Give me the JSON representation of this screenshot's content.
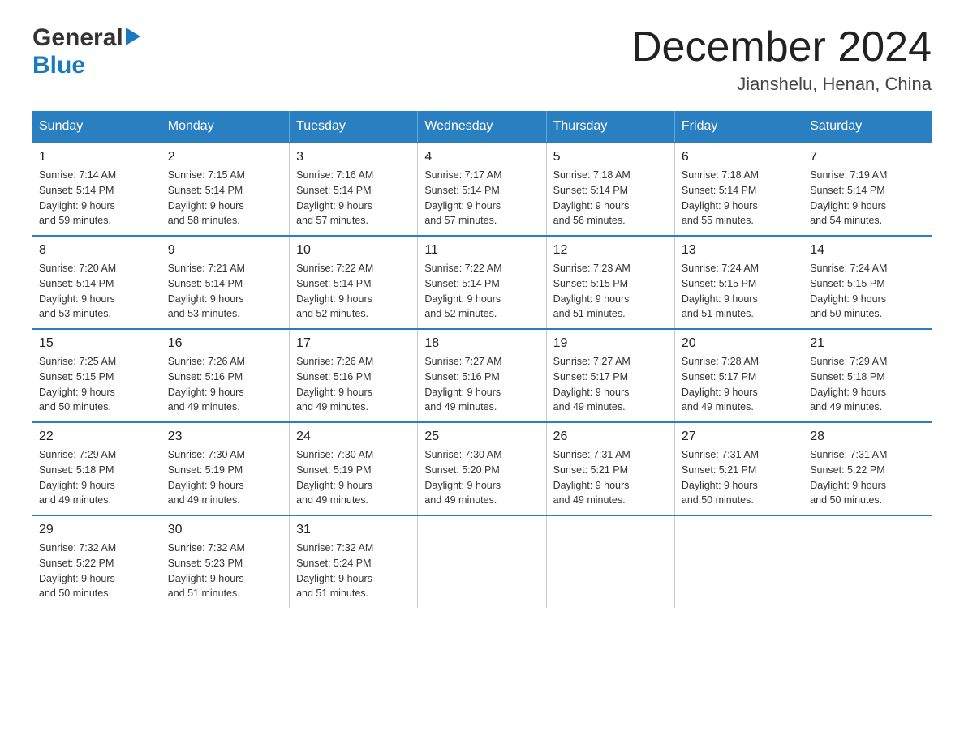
{
  "logo": {
    "general_text": "General",
    "blue_text": "Blue"
  },
  "title": "December 2024",
  "subtitle": "Jianshelu, Henan, China",
  "days_of_week": [
    "Sunday",
    "Monday",
    "Tuesday",
    "Wednesday",
    "Thursday",
    "Friday",
    "Saturday"
  ],
  "weeks": [
    [
      {
        "day": "1",
        "sunrise": "7:14 AM",
        "sunset": "5:14 PM",
        "daylight": "9 hours and 59 minutes."
      },
      {
        "day": "2",
        "sunrise": "7:15 AM",
        "sunset": "5:14 PM",
        "daylight": "9 hours and 58 minutes."
      },
      {
        "day": "3",
        "sunrise": "7:16 AM",
        "sunset": "5:14 PM",
        "daylight": "9 hours and 57 minutes."
      },
      {
        "day": "4",
        "sunrise": "7:17 AM",
        "sunset": "5:14 PM",
        "daylight": "9 hours and 57 minutes."
      },
      {
        "day": "5",
        "sunrise": "7:18 AM",
        "sunset": "5:14 PM",
        "daylight": "9 hours and 56 minutes."
      },
      {
        "day": "6",
        "sunrise": "7:18 AM",
        "sunset": "5:14 PM",
        "daylight": "9 hours and 55 minutes."
      },
      {
        "day": "7",
        "sunrise": "7:19 AM",
        "sunset": "5:14 PM",
        "daylight": "9 hours and 54 minutes."
      }
    ],
    [
      {
        "day": "8",
        "sunrise": "7:20 AM",
        "sunset": "5:14 PM",
        "daylight": "9 hours and 53 minutes."
      },
      {
        "day": "9",
        "sunrise": "7:21 AM",
        "sunset": "5:14 PM",
        "daylight": "9 hours and 53 minutes."
      },
      {
        "day": "10",
        "sunrise": "7:22 AM",
        "sunset": "5:14 PM",
        "daylight": "9 hours and 52 minutes."
      },
      {
        "day": "11",
        "sunrise": "7:22 AM",
        "sunset": "5:14 PM",
        "daylight": "9 hours and 52 minutes."
      },
      {
        "day": "12",
        "sunrise": "7:23 AM",
        "sunset": "5:15 PM",
        "daylight": "9 hours and 51 minutes."
      },
      {
        "day": "13",
        "sunrise": "7:24 AM",
        "sunset": "5:15 PM",
        "daylight": "9 hours and 51 minutes."
      },
      {
        "day": "14",
        "sunrise": "7:24 AM",
        "sunset": "5:15 PM",
        "daylight": "9 hours and 50 minutes."
      }
    ],
    [
      {
        "day": "15",
        "sunrise": "7:25 AM",
        "sunset": "5:15 PM",
        "daylight": "9 hours and 50 minutes."
      },
      {
        "day": "16",
        "sunrise": "7:26 AM",
        "sunset": "5:16 PM",
        "daylight": "9 hours and 49 minutes."
      },
      {
        "day": "17",
        "sunrise": "7:26 AM",
        "sunset": "5:16 PM",
        "daylight": "9 hours and 49 minutes."
      },
      {
        "day": "18",
        "sunrise": "7:27 AM",
        "sunset": "5:16 PM",
        "daylight": "9 hours and 49 minutes."
      },
      {
        "day": "19",
        "sunrise": "7:27 AM",
        "sunset": "5:17 PM",
        "daylight": "9 hours and 49 minutes."
      },
      {
        "day": "20",
        "sunrise": "7:28 AM",
        "sunset": "5:17 PM",
        "daylight": "9 hours and 49 minutes."
      },
      {
        "day": "21",
        "sunrise": "7:29 AM",
        "sunset": "5:18 PM",
        "daylight": "9 hours and 49 minutes."
      }
    ],
    [
      {
        "day": "22",
        "sunrise": "7:29 AM",
        "sunset": "5:18 PM",
        "daylight": "9 hours and 49 minutes."
      },
      {
        "day": "23",
        "sunrise": "7:30 AM",
        "sunset": "5:19 PM",
        "daylight": "9 hours and 49 minutes."
      },
      {
        "day": "24",
        "sunrise": "7:30 AM",
        "sunset": "5:19 PM",
        "daylight": "9 hours and 49 minutes."
      },
      {
        "day": "25",
        "sunrise": "7:30 AM",
        "sunset": "5:20 PM",
        "daylight": "9 hours and 49 minutes."
      },
      {
        "day": "26",
        "sunrise": "7:31 AM",
        "sunset": "5:21 PM",
        "daylight": "9 hours and 49 minutes."
      },
      {
        "day": "27",
        "sunrise": "7:31 AM",
        "sunset": "5:21 PM",
        "daylight": "9 hours and 50 minutes."
      },
      {
        "day": "28",
        "sunrise": "7:31 AM",
        "sunset": "5:22 PM",
        "daylight": "9 hours and 50 minutes."
      }
    ],
    [
      {
        "day": "29",
        "sunrise": "7:32 AM",
        "sunset": "5:22 PM",
        "daylight": "9 hours and 50 minutes."
      },
      {
        "day": "30",
        "sunrise": "7:32 AM",
        "sunset": "5:23 PM",
        "daylight": "9 hours and 51 minutes."
      },
      {
        "day": "31",
        "sunrise": "7:32 AM",
        "sunset": "5:24 PM",
        "daylight": "9 hours and 51 minutes."
      },
      null,
      null,
      null,
      null
    ]
  ],
  "labels": {
    "sunrise": "Sunrise:",
    "sunset": "Sunset:",
    "daylight": "Daylight:"
  }
}
